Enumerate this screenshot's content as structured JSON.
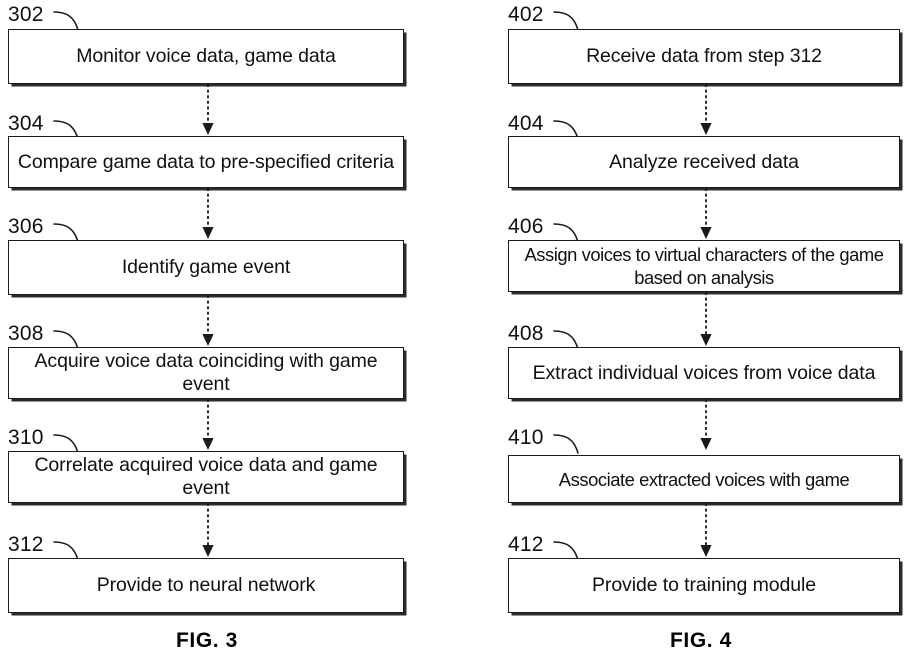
{
  "document": {
    "type": "patent-flowchart-sheet",
    "figure_count": 2
  },
  "figures": [
    {
      "id": "figure-3",
      "caption": "FIG. 3",
      "column": "left",
      "steps": [
        {
          "ref": "302",
          "text": "Monitor voice data, game data",
          "lines": 1
        },
        {
          "ref": "304",
          "text": "Compare game data to pre-specified criteria",
          "lines": 2
        },
        {
          "ref": "306",
          "text": "Identify game event",
          "lines": 1
        },
        {
          "ref": "308",
          "text": "Acquire voice data coinciding with game event",
          "lines": 2
        },
        {
          "ref": "310",
          "text": "Correlate acquired voice data and game event",
          "lines": 2
        },
        {
          "ref": "312",
          "text": "Provide to neural network",
          "lines": 1
        }
      ],
      "connectors": [
        {
          "from": "302",
          "to": "304",
          "style": "dashed-arrow"
        },
        {
          "from": "304",
          "to": "306",
          "style": "dashed-arrow"
        },
        {
          "from": "306",
          "to": "308",
          "style": "dashed-arrow"
        },
        {
          "from": "308",
          "to": "310",
          "style": "dashed-arrow"
        },
        {
          "from": "310",
          "to": "312",
          "style": "dashed-arrow"
        }
      ]
    },
    {
      "id": "figure-4",
      "caption": "FIG. 4",
      "column": "right",
      "steps": [
        {
          "ref": "402",
          "text": "Receive data from step 312",
          "lines": 1
        },
        {
          "ref": "404",
          "text": "Analyze received data",
          "lines": 1
        },
        {
          "ref": "406",
          "text": "Assign voices to virtual characters of the game based on analysis",
          "lines": 2
        },
        {
          "ref": "408",
          "text": "Extract individual voices from voice data",
          "lines": 2
        },
        {
          "ref": "410",
          "text": "Associate extracted voices with game",
          "lines": 1
        },
        {
          "ref": "412",
          "text": "Provide to training module",
          "lines": 1
        }
      ],
      "connectors": [
        {
          "from": "402",
          "to": "404",
          "style": "dashed-arrow"
        },
        {
          "from": "404",
          "to": "406",
          "style": "dashed-arrow"
        },
        {
          "from": "406",
          "to": "408",
          "style": "dashed-arrow"
        },
        {
          "from": "408",
          "to": "410",
          "style": "dashed-arrow"
        },
        {
          "from": "410",
          "to": "412",
          "style": "dashed-arrow"
        }
      ]
    }
  ],
  "colors": {
    "ink": "#111111",
    "border": "#1a1a1a",
    "shadow": "#2b2b2b",
    "background": "#ffffff"
  }
}
